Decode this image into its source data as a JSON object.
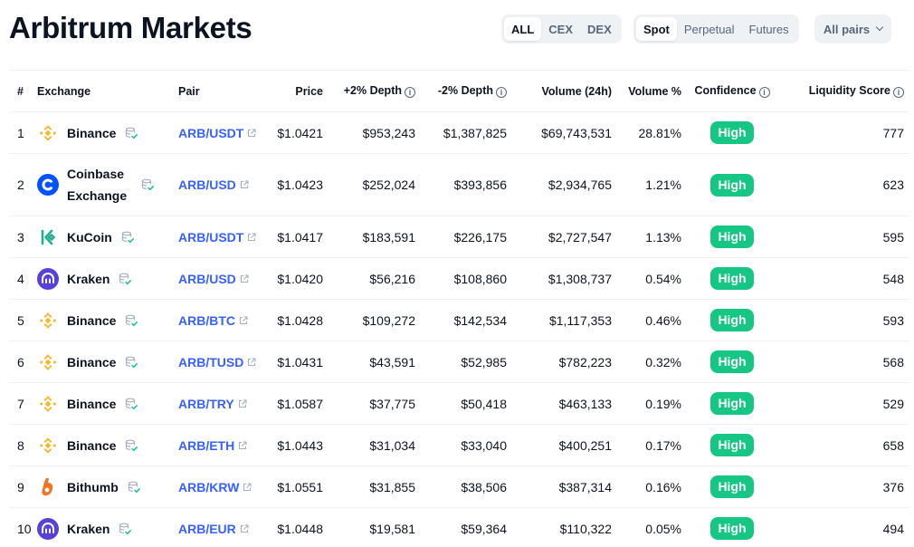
{
  "page": {
    "title": "Arbitrum Markets"
  },
  "filters": {
    "type_tabs": [
      {
        "label": "ALL",
        "active": true
      },
      {
        "label": "CEX",
        "active": false
      },
      {
        "label": "DEX",
        "active": false
      }
    ],
    "market_tabs": [
      {
        "label": "Spot",
        "active": true
      },
      {
        "label": "Perpetual",
        "active": false
      },
      {
        "label": "Futures",
        "active": false
      }
    ],
    "pairs_dropdown": {
      "label": "All pairs"
    }
  },
  "table": {
    "headers": {
      "rank": "#",
      "exchange": "Exchange",
      "pair": "Pair",
      "price": "Price",
      "plus_depth": "+2% Depth",
      "minus_depth": "-2% Depth",
      "volume": "Volume (24h)",
      "volume_pct": "Volume %",
      "confidence": "Confidence",
      "liquidity": "Liquidity Score"
    },
    "rows": [
      {
        "rank": "1",
        "exchange": "Binance",
        "logo": "binance-logo",
        "pair": "ARB/USDT",
        "price": "$1.0421",
        "plus_depth": "$953,243",
        "minus_depth": "$1,387,825",
        "volume": "$69,743,531",
        "volume_pct": "28.81%",
        "confidence": "High",
        "liquidity": "777",
        "tall": false
      },
      {
        "rank": "2",
        "exchange": "Coinbase Exchange",
        "logo": "coinbase-logo",
        "pair": "ARB/USD",
        "price": "$1.0423",
        "plus_depth": "$252,024",
        "minus_depth": "$393,856",
        "volume": "$2,934,765",
        "volume_pct": "1.21%",
        "confidence": "High",
        "liquidity": "623",
        "tall": true
      },
      {
        "rank": "3",
        "exchange": "KuCoin",
        "logo": "kucoin-logo",
        "pair": "ARB/USDT",
        "price": "$1.0417",
        "plus_depth": "$183,591",
        "minus_depth": "$226,175",
        "volume": "$2,727,547",
        "volume_pct": "1.13%",
        "confidence": "High",
        "liquidity": "595",
        "tall": false
      },
      {
        "rank": "4",
        "exchange": "Kraken",
        "logo": "kraken-logo",
        "pair": "ARB/USD",
        "price": "$1.0420",
        "plus_depth": "$56,216",
        "minus_depth": "$108,860",
        "volume": "$1,308,737",
        "volume_pct": "0.54%",
        "confidence": "High",
        "liquidity": "548",
        "tall": false
      },
      {
        "rank": "5",
        "exchange": "Binance",
        "logo": "binance-logo",
        "pair": "ARB/BTC",
        "price": "$1.0428",
        "plus_depth": "$109,272",
        "minus_depth": "$142,534",
        "volume": "$1,117,353",
        "volume_pct": "0.46%",
        "confidence": "High",
        "liquidity": "593",
        "tall": false
      },
      {
        "rank": "6",
        "exchange": "Binance",
        "logo": "binance-logo",
        "pair": "ARB/TUSD",
        "price": "$1.0431",
        "plus_depth": "$43,591",
        "minus_depth": "$52,985",
        "volume": "$782,223",
        "volume_pct": "0.32%",
        "confidence": "High",
        "liquidity": "568",
        "tall": false
      },
      {
        "rank": "7",
        "exchange": "Binance",
        "logo": "binance-logo",
        "pair": "ARB/TRY",
        "price": "$1.0587",
        "plus_depth": "$37,775",
        "minus_depth": "$50,418",
        "volume": "$463,133",
        "volume_pct": "0.19%",
        "confidence": "High",
        "liquidity": "529",
        "tall": false
      },
      {
        "rank": "8",
        "exchange": "Binance",
        "logo": "binance-logo",
        "pair": "ARB/ETH",
        "price": "$1.0443",
        "plus_depth": "$31,034",
        "minus_depth": "$33,040",
        "volume": "$400,251",
        "volume_pct": "0.17%",
        "confidence": "High",
        "liquidity": "658",
        "tall": false
      },
      {
        "rank": "9",
        "exchange": "Bithumb",
        "logo": "bithumb-logo",
        "pair": "ARB/KRW",
        "price": "$1.0551",
        "plus_depth": "$31,855",
        "minus_depth": "$38,506",
        "volume": "$387,314",
        "volume_pct": "0.16%",
        "confidence": "High",
        "liquidity": "376",
        "tall": false
      },
      {
        "rank": "10",
        "exchange": "Kraken",
        "logo": "kraken-logo",
        "pair": "ARB/EUR",
        "price": "$1.0448",
        "plus_depth": "$19,581",
        "minus_depth": "$59,364",
        "volume": "$110,322",
        "volume_pct": "0.05%",
        "confidence": "High",
        "liquidity": "494",
        "tall": false
      }
    ]
  },
  "colors": {
    "link": "#3861fb",
    "badge_high": "#16c784",
    "binance": "#f3ba2f",
    "coinbase": "#0052ff",
    "kucoin": "#23af91",
    "kraken": "#5741d9",
    "bithumb": "#f37321",
    "verified": "#16c784"
  }
}
